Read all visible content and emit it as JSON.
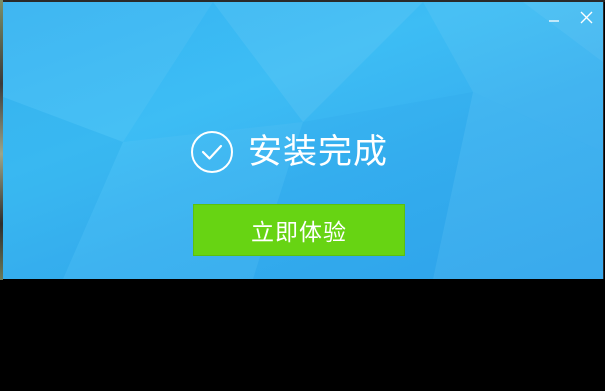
{
  "window": {
    "status_text": "安装完成",
    "primary_button_label": "立即体验"
  },
  "icons": {
    "minimize": "minimize-icon",
    "close": "close-icon",
    "check": "check-circle-icon"
  },
  "colors": {
    "window_background": "#3dbdf4",
    "button_background": "#67d413",
    "text": "#ffffff"
  }
}
